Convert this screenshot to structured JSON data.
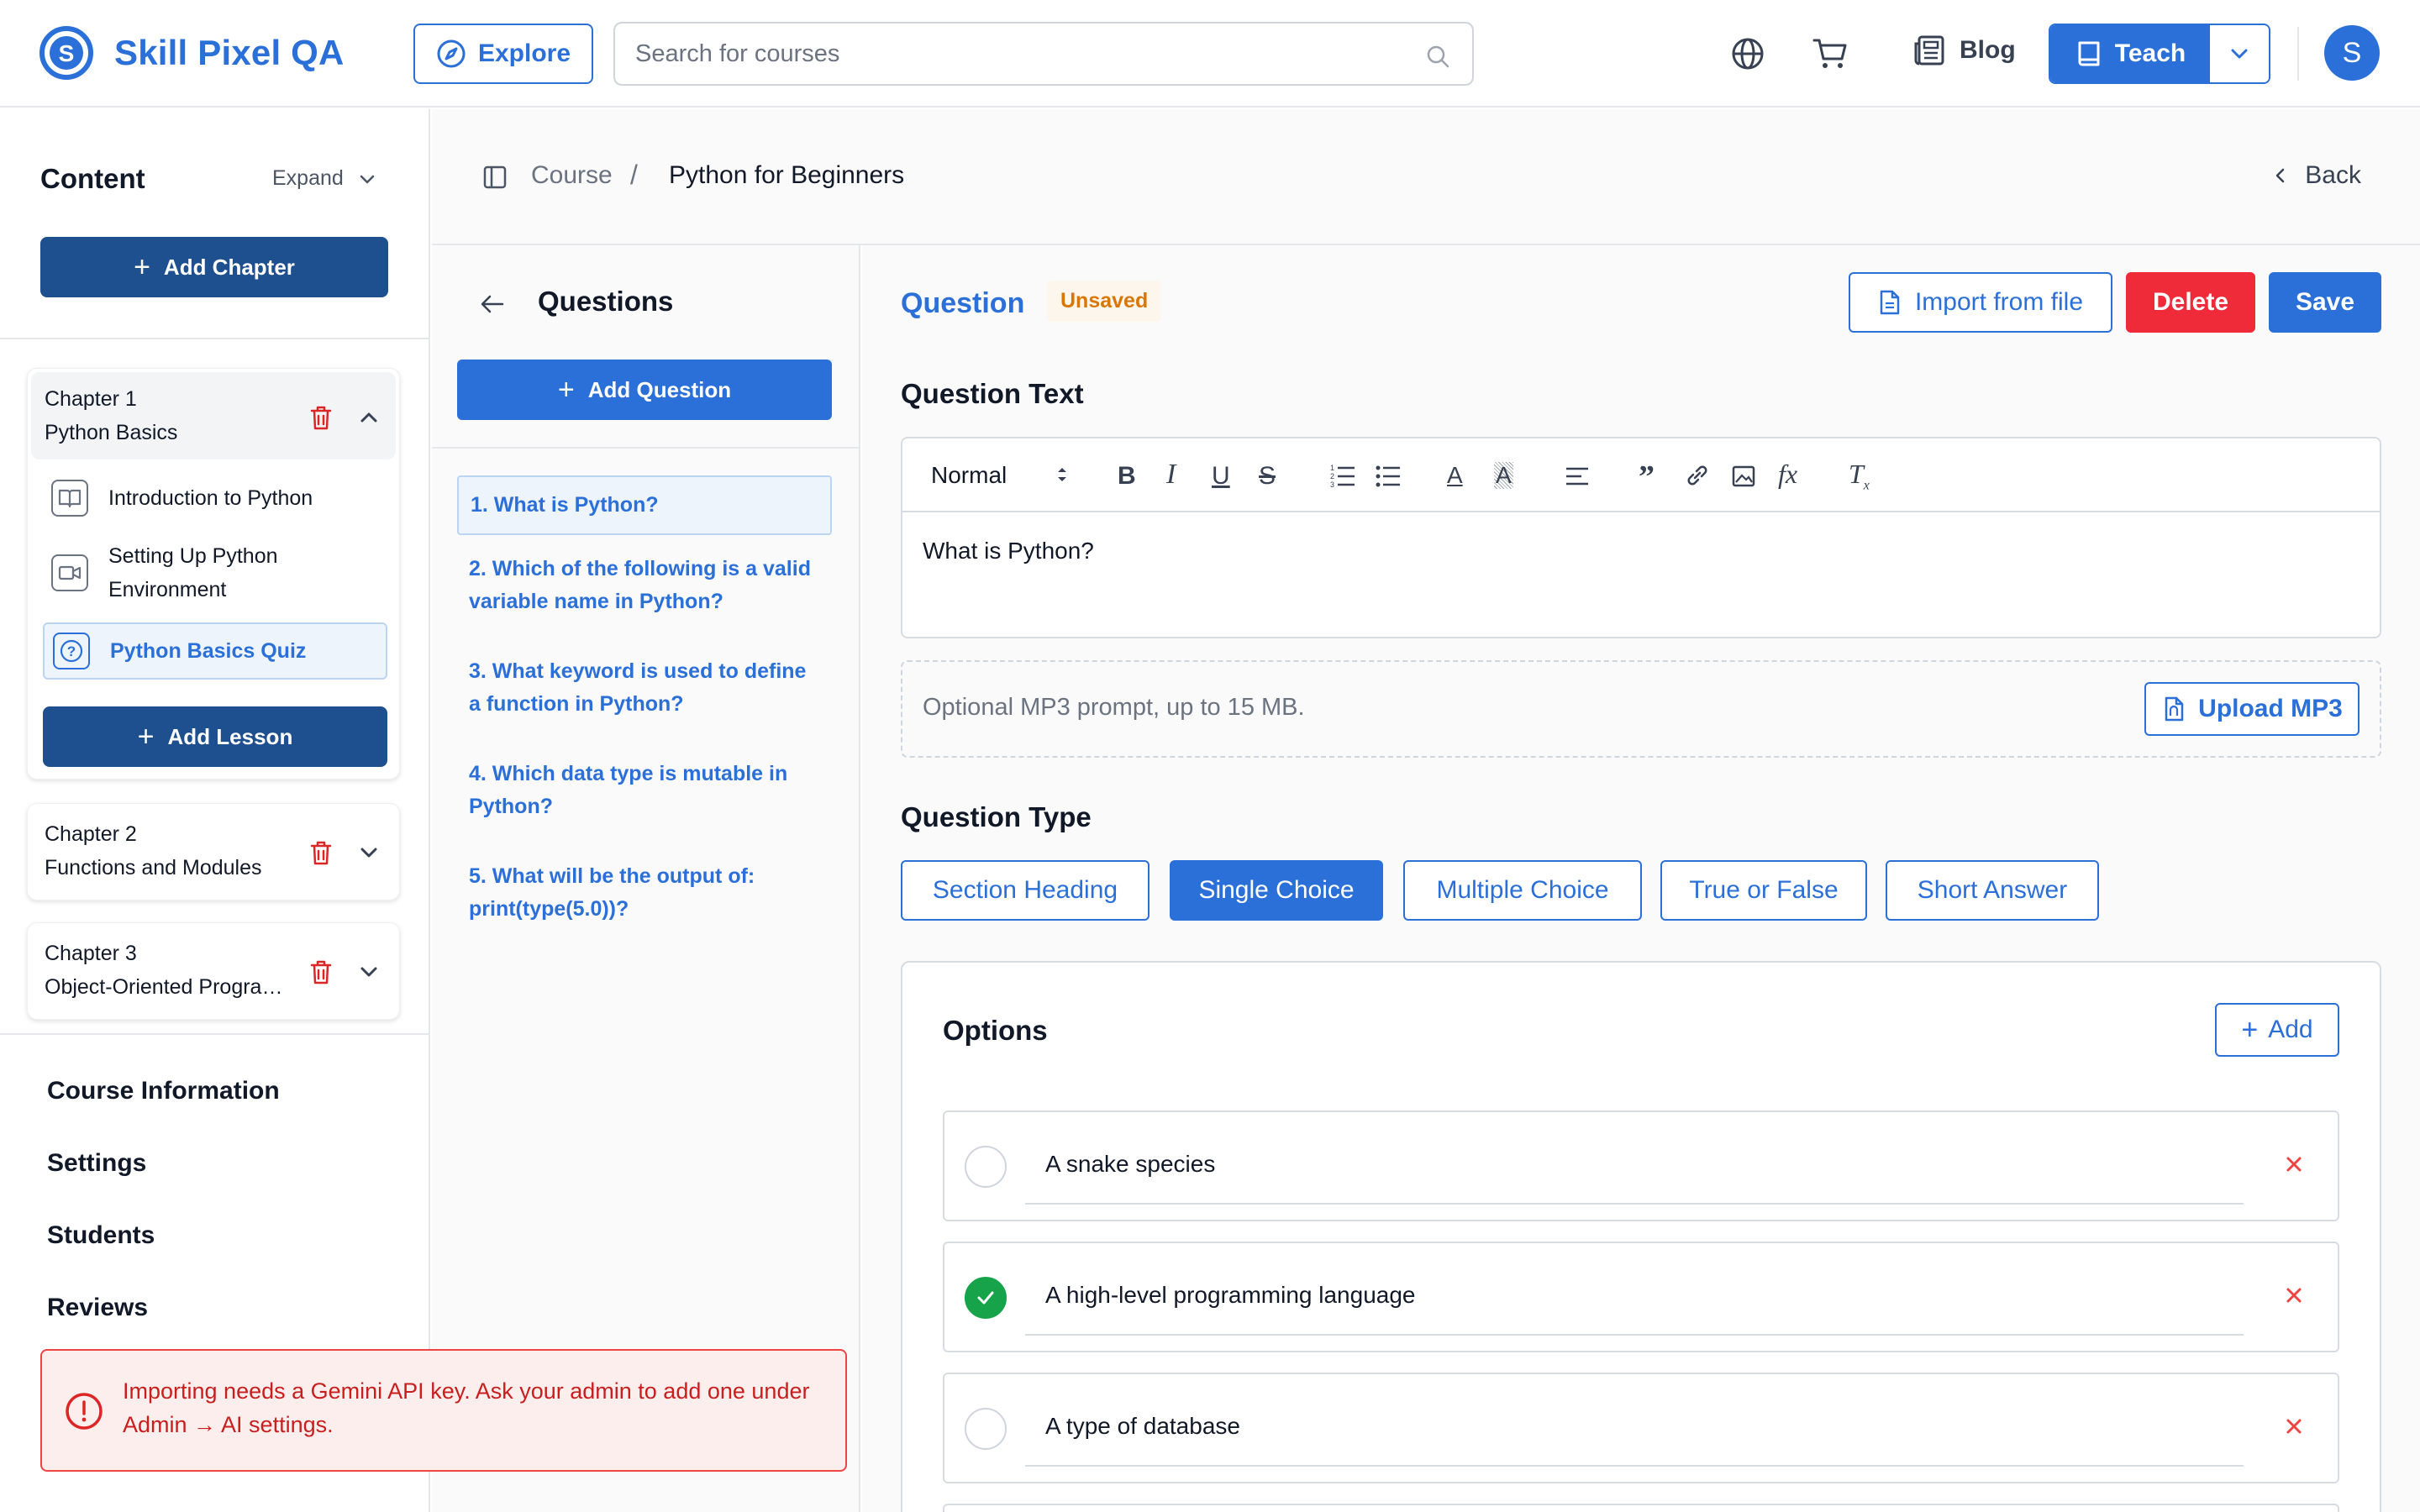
{
  "header": {
    "app_name": "Skill Pixel QA",
    "explore_label": "Explore",
    "search_placeholder": "Search for courses",
    "blog_label": "Blog",
    "teach_label": "Teach",
    "avatar_initial": "S",
    "brand_color": "#2b6fd8"
  },
  "sidebar": {
    "title": "Content",
    "expand_label": "Expand",
    "add_chapter_label": "Add Chapter",
    "chapters": [
      {
        "number": "Chapter 1",
        "name": "Python Basics",
        "expanded": true,
        "lessons": [
          {
            "label": "Introduction to Python",
            "icon": "book-icon"
          },
          {
            "label": "Setting Up Python Environment",
            "icon": "video-icon"
          },
          {
            "label": "Python Basics Quiz",
            "icon": "quiz-icon",
            "active": true
          }
        ],
        "add_lesson_label": "Add Lesson"
      },
      {
        "number": "Chapter 2",
        "name": "Functions and Modules",
        "expanded": false
      },
      {
        "number": "Chapter 3",
        "name": "Object-Oriented Programming",
        "expanded": false
      }
    ],
    "nav": [
      "Course Information",
      "Settings",
      "Students",
      "Reviews"
    ]
  },
  "breadcrumb": {
    "root": "Course",
    "current": "Python for Beginners",
    "back_label": "Back"
  },
  "questions": {
    "title": "Questions",
    "add_label": "Add Question",
    "items": [
      "1. What is Python?",
      "2. Which of the following is a valid variable name in Python?",
      "3. What keyword is used to define a function in Python?",
      "4. Which data type is mutable in Python?",
      "5. What will be the output of: print(type(5.0))?"
    ]
  },
  "editor": {
    "title": "Question",
    "status_badge": "Unsaved",
    "import_label": "Import from file",
    "delete_label": "Delete",
    "save_label": "Save",
    "question_text_label": "Question Text",
    "format_select": "Normal",
    "question_text": "What is Python?",
    "mp3_prompt": "Optional MP3 prompt, up to 15 MB.",
    "upload_label": "Upload MP3",
    "question_type_label": "Question Type",
    "question_types": [
      "Section Heading",
      "Single Choice",
      "Multiple Choice",
      "True or False",
      "Short Answer"
    ],
    "selected_type": "Single Choice",
    "options_title": "Options",
    "add_option_label": "Add",
    "options": [
      {
        "text": "A snake species",
        "correct": false
      },
      {
        "text": "A high-level programming language",
        "correct": true
      },
      {
        "text": "A type of database",
        "correct": false
      }
    ]
  },
  "toast": {
    "message": "Importing needs a Gemini API key. Ask your admin to add one under Admin → AI settings.",
    "color": "#c81e1e"
  }
}
